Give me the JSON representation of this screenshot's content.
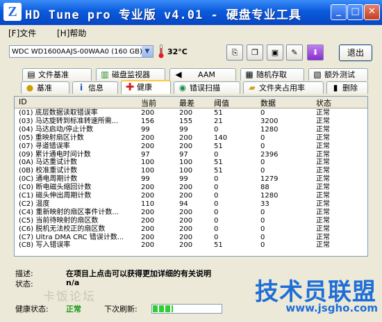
{
  "window": {
    "icon_letter": "Z",
    "title": "HD Tune pro 专业版 v4.01 - 硬盘专业工具",
    "minimize": "_",
    "maximize": "□",
    "close": "✕"
  },
  "menu": [
    {
      "label": "[F]文件"
    },
    {
      "label": "[H]帮助"
    }
  ],
  "toolbar": {
    "drive": "WDC WD1600AAJS-00WAA0 (160 GB)",
    "temperature": "32°C",
    "exit_label": "退出",
    "icons": [
      "copy-icon",
      "copy-screenshot-icon",
      "save-icon",
      "options-icon",
      "download-icon"
    ]
  },
  "tabs_row1": [
    {
      "label": "文件基准",
      "icon": "file-benchmark-icon"
    },
    {
      "label": "磁盘监视器",
      "icon": "disk-monitor-icon"
    },
    {
      "label": "AAM",
      "icon": "speaker-icon"
    },
    {
      "label": "随机存取",
      "icon": "random-access-icon"
    },
    {
      "label": "额外测试",
      "icon": "extra-tests-icon"
    }
  ],
  "tabs_row2": [
    {
      "label": "基准",
      "icon": "benchmark-icon"
    },
    {
      "label": "信息",
      "icon": "info-icon"
    },
    {
      "label": "健康",
      "icon": "health-cross-icon"
    },
    {
      "label": "错误扫描",
      "icon": "error-scan-icon"
    },
    {
      "label": "文件夹占用率",
      "icon": "folder-usage-icon"
    },
    {
      "label": "删除",
      "icon": "erase-icon"
    }
  ],
  "table": {
    "headers": [
      "ID",
      "当前",
      "最差",
      "阈值",
      "数据",
      "状态"
    ],
    "rows": [
      [
        "(01) 底层数据读取错误率",
        "200",
        "200",
        "51",
        "0",
        "正常"
      ],
      [
        "(03) 马达旋转到标准转速所需...",
        "156",
        "155",
        "21",
        "3200",
        "正常"
      ],
      [
        "(04) 马达启动/停止计数",
        "99",
        "99",
        "0",
        "1280",
        "正常"
      ],
      [
        "(05) 重映射扇区计数",
        "200",
        "200",
        "140",
        "0",
        "正常"
      ],
      [
        "(07) 寻道错误率",
        "200",
        "200",
        "51",
        "0",
        "正常"
      ],
      [
        "(09) 累计通电时间计数",
        "97",
        "97",
        "0",
        "2396",
        "正常"
      ],
      [
        "(0A) 马达重试计数",
        "100",
        "100",
        "51",
        "0",
        "正常"
      ],
      [
        "(0B) 校准重试计数",
        "100",
        "100",
        "51",
        "0",
        "正常"
      ],
      [
        "(0C) 通电周期计数",
        "99",
        "99",
        "0",
        "1279",
        "正常"
      ],
      [
        "(C0) 断电磁头缩回计数",
        "200",
        "200",
        "0",
        "88",
        "正常"
      ],
      [
        "(C1) 磁头伸出周期计数",
        "200",
        "200",
        "0",
        "1280",
        "正常"
      ],
      [
        "(C2) 温度",
        "110",
        "94",
        "0",
        "33",
        "正常"
      ],
      [
        "(C4) 重新映射的扇区事件计数...",
        "200",
        "200",
        "0",
        "0",
        "正常"
      ],
      [
        "(C5) 当前待映射的扇区数",
        "200",
        "200",
        "0",
        "0",
        "正常"
      ],
      [
        "(C6) 脱机无法校正的扇区数",
        "200",
        "200",
        "0",
        "0",
        "正常"
      ],
      [
        "(C7) Ultra DMA CRC 错误计数...",
        "200",
        "200",
        "0",
        "0",
        "正常"
      ],
      [
        "(C8) 写入错误率",
        "200",
        "200",
        "51",
        "0",
        "正常"
      ]
    ]
  },
  "info": {
    "description_label": "描述:",
    "description": "在项目上点击可以获得更加详细的有关说明",
    "status_label": "状态:",
    "status": "n/a"
  },
  "status_bar": {
    "health_label": "健康状态:",
    "health_value": "正常",
    "next_refresh_label": "下次刷新:",
    "refresh_progress": 0.3
  },
  "overlay": {
    "faded_text": "卡饭论坛",
    "watermark": "技术员联盟",
    "watermark_url": "www.jsgho.com"
  }
}
